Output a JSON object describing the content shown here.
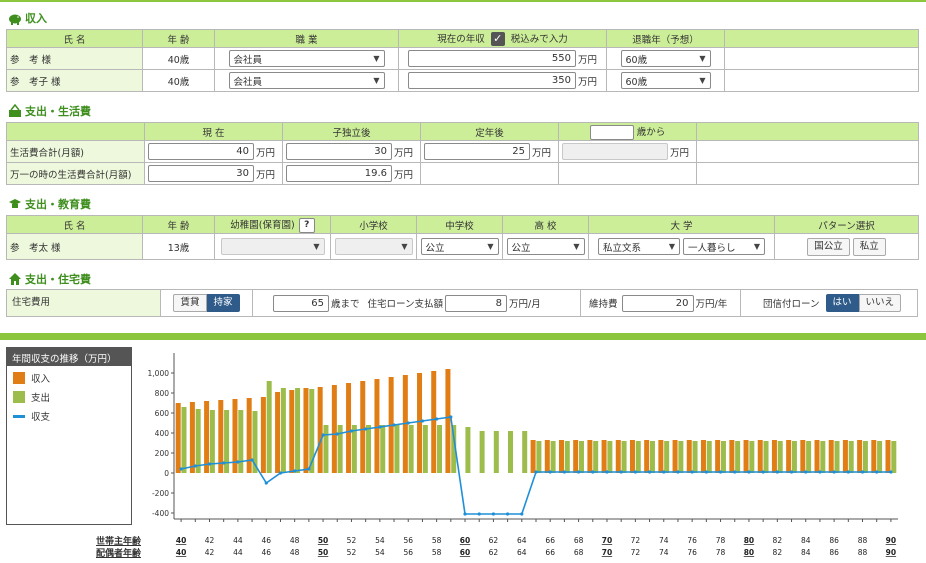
{
  "colors": {
    "income": "#e07d14",
    "expense": "#9cbd4b",
    "balance": "#1f8fd8",
    "header": "#ccee99",
    "title": "#3f8f1f"
  },
  "income": {
    "title": "収入",
    "headers": [
      "氏 名",
      "年 齢",
      "職 業",
      "現在の年収",
      "税込みで入力",
      "退職年（予想）"
    ],
    "rows": [
      {
        "name": "参　考 様",
        "age": "40歳",
        "job": "会社員",
        "income": "550",
        "unit": "万円",
        "retire": "60歳"
      },
      {
        "name": "参　考子 様",
        "age": "40歳",
        "job": "会社員",
        "income": "350",
        "unit": "万円",
        "retire": "60歳"
      }
    ]
  },
  "living": {
    "title": "支出・生活費",
    "headers": [
      "現 在",
      "子独立後",
      "定年後",
      "歳から"
    ],
    "rows": [
      {
        "label": "生活費合計(月額)",
        "values": [
          "40",
          "30",
          "25",
          ""
        ],
        "unit": "万円"
      },
      {
        "label": "万一の時の生活費合計(月額)",
        "values": [
          "30",
          "19.6"
        ],
        "unit": "万円"
      }
    ]
  },
  "education": {
    "title": "支出・教育費",
    "headers": [
      "氏 名",
      "年 齢",
      "幼稚園(保育園)",
      "?",
      "小学校",
      "中学校",
      "高 校",
      "大 学",
      "パターン選択"
    ],
    "row": {
      "name": "参　考太 様",
      "age": "13歳",
      "kinder": "",
      "elementary": "",
      "junior": "公立",
      "high": "公立",
      "univ": "私立文系",
      "living": "一人暮らし"
    },
    "pattern_buttons": [
      "国公立",
      "私立"
    ]
  },
  "housing": {
    "title": "支出・住宅費",
    "label": "住宅費用",
    "tabs": [
      "賃貸",
      "持家"
    ],
    "active_tab": "持家",
    "until_age": "65",
    "until_label": "歳まで",
    "loan_label": "住宅ローン支払額",
    "loan_value": "8",
    "loan_unit": "万円/月",
    "maint_label": "維持費",
    "maint_value": "20",
    "maint_unit": "万円/年",
    "group_label": "団信付ローン",
    "yes": "はい",
    "no": "いいえ"
  },
  "legend": {
    "title": "年間収支の推移（万円）",
    "items": [
      "収入",
      "支出",
      "収支"
    ]
  },
  "age_rows": {
    "owner_label": "世帯主年齢",
    "spouse_label": "配偶者年齢"
  },
  "chart_data": {
    "type": "bar",
    "y_ticks": [
      "1,000",
      "800",
      "600",
      "400",
      "200",
      "0",
      "-200",
      "-400"
    ],
    "ylim": [
      -460,
      1200
    ],
    "x_ages": [
      40,
      41,
      42,
      43,
      44,
      45,
      46,
      47,
      48,
      49,
      50,
      51,
      52,
      53,
      54,
      55,
      56,
      57,
      58,
      59,
      60,
      61,
      62,
      63,
      64,
      65,
      66,
      67,
      68,
      69,
      70,
      71,
      72,
      73,
      74,
      75,
      76,
      77,
      78,
      79,
      80,
      81,
      82,
      83,
      84,
      85,
      86,
      87,
      88,
      89,
      90
    ],
    "x_tick_labels": [
      "40",
      "42",
      "44",
      "46",
      "48",
      "50",
      "52",
      "54",
      "56",
      "58",
      "60",
      "62",
      "64",
      "66",
      "68",
      "70",
      "72",
      "74",
      "76",
      "78",
      "80",
      "82",
      "84",
      "86",
      "88",
      "90"
    ],
    "series": [
      {
        "name": "収入",
        "values": [
          700,
          710,
          720,
          730,
          740,
          750,
          760,
          810,
          830,
          850,
          860,
          880,
          900,
          920,
          940,
          960,
          980,
          1000,
          1020,
          1040,
          0,
          0,
          0,
          0,
          0,
          330,
          330,
          330,
          330,
          330,
          330,
          330,
          330,
          330,
          330,
          330,
          330,
          330,
          330,
          330,
          330,
          330,
          330,
          330,
          330,
          330,
          330,
          330,
          330,
          330,
          330
        ]
      },
      {
        "name": "支出",
        "values": [
          660,
          640,
          630,
          630,
          630,
          620,
          920,
          850,
          850,
          840,
          480,
          480,
          480,
          480,
          480,
          480,
          480,
          480,
          480,
          480,
          460,
          420,
          420,
          420,
          420,
          320,
          320,
          320,
          320,
          320,
          320,
          320,
          320,
          320,
          320,
          320,
          320,
          320,
          320,
          320,
          320,
          320,
          320,
          320,
          320,
          320,
          320,
          320,
          320,
          320,
          320
        ]
      },
      {
        "name": "収支",
        "values": [
          40,
          70,
          90,
          100,
          110,
          130,
          -100,
          0,
          20,
          40,
          380,
          390,
          420,
          440,
          460,
          480,
          500,
          520,
          540,
          560,
          -410,
          -410,
          -410,
          -410,
          -410,
          10,
          10,
          10,
          10,
          10,
          10,
          10,
          10,
          10,
          10,
          10,
          10,
          10,
          10,
          10,
          10,
          10,
          10,
          10,
          10,
          10,
          10,
          10,
          10,
          10,
          10
        ]
      }
    ]
  }
}
